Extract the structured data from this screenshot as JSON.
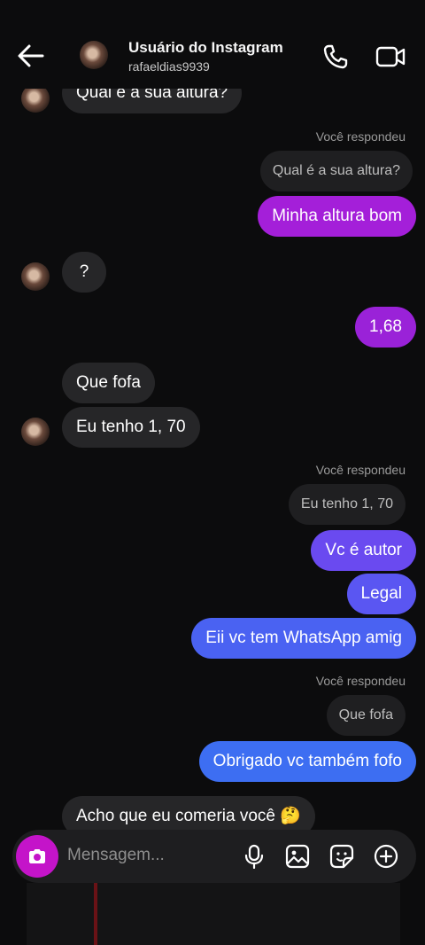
{
  "header": {
    "name": "Usuário do Instagram",
    "username": "rafaeldias9939"
  },
  "messages": {
    "m1": "Qual é a sua altura?",
    "reply_label_1": "Você respondeu",
    "reply_chip_1": "Qual é a sua altura?",
    "m2": "Minha altura bom",
    "m3": "?",
    "m4": "1,68",
    "m5": "Que fofa",
    "m6": "Eu tenho 1, 70",
    "reply_label_2": "Você respondeu",
    "reply_chip_2": "Eu tenho 1, 70",
    "m7": "Vc é autor",
    "m8": "Legal",
    "m9": "Eii vc tem WhatsApp amig",
    "reply_label_3": "Você respondeu",
    "reply_chip_3": "Que fofa",
    "m10": "Obrigado vc também fofo",
    "m11": "Acho que eu comeria você 🤔"
  },
  "composer": {
    "placeholder": "Mensagem..."
  },
  "colors": {
    "sent_purple": "#a41fd9",
    "sent_violet": "#6a4af0",
    "sent_blue": "#3d6ef2",
    "received": "#262628",
    "camera": "#c414c9"
  },
  "icons": [
    "back-arrow-icon",
    "phone-icon",
    "video-camera-icon",
    "camera-icon",
    "microphone-icon",
    "image-icon",
    "sticker-icon",
    "plus-icon"
  ]
}
